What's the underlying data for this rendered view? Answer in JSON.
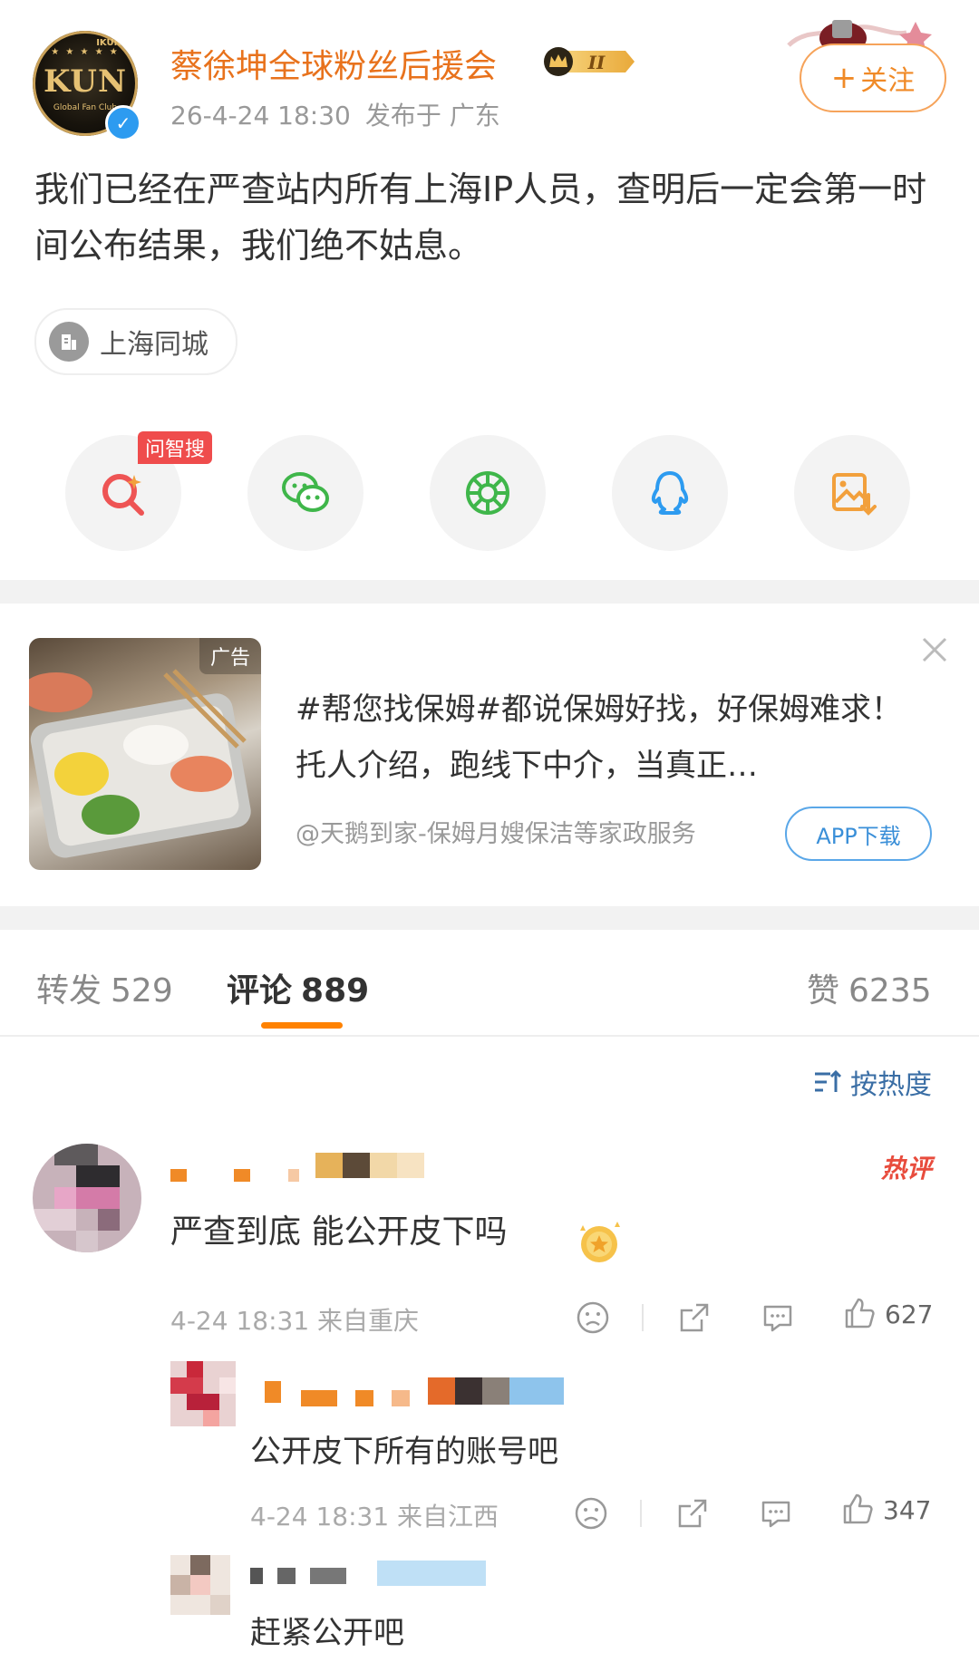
{
  "post": {
    "author": "蔡徐坤全球粉丝后援会",
    "level_badge": "II",
    "avatar_text": "KUN",
    "avatar_small": "Global Fan Club",
    "avatar_corner": "IKUN",
    "time": "26-4-24 18:30",
    "location": "发布于 广东",
    "follow_label": "关注",
    "text": "我们已经在严查站内所有上海IP人员，查明后一定会第一时间公布结果，我们绝不姑息。",
    "location_tag": "上海同城"
  },
  "share": {
    "ai_tag": "问智搜",
    "items": [
      "ai-search",
      "wechat",
      "moments",
      "qq",
      "save-image"
    ]
  },
  "ad": {
    "label": "广告",
    "text": "#帮您找保姆#都说保姆好找，好保姆难求！托人介绍，跑线下中介，当真正…",
    "source": "@天鹅到家-保姆月嫂保洁等家政服务",
    "button": "APP下载"
  },
  "tabs": {
    "repost_label": "转发",
    "repost_count": "529",
    "comment_label": "评论",
    "comment_count": "889",
    "like_label": "赞",
    "like_count": "6235"
  },
  "sort_label": "按热度",
  "hot_label": "热评",
  "comments": [
    {
      "text": "严查到底 能公开皮下吗",
      "time": "4-24 18:31",
      "from": "来自重庆",
      "likes": "627"
    }
  ],
  "replies": [
    {
      "text": "公开皮下所有的账号吧",
      "time": "4-24 18:31",
      "from": "来自江西",
      "likes": "347"
    },
    {
      "text": "赶紧公开吧"
    }
  ],
  "colors": {
    "accent": "#ff8200",
    "name": "#e8721c",
    "link": "#3a6ea5"
  }
}
